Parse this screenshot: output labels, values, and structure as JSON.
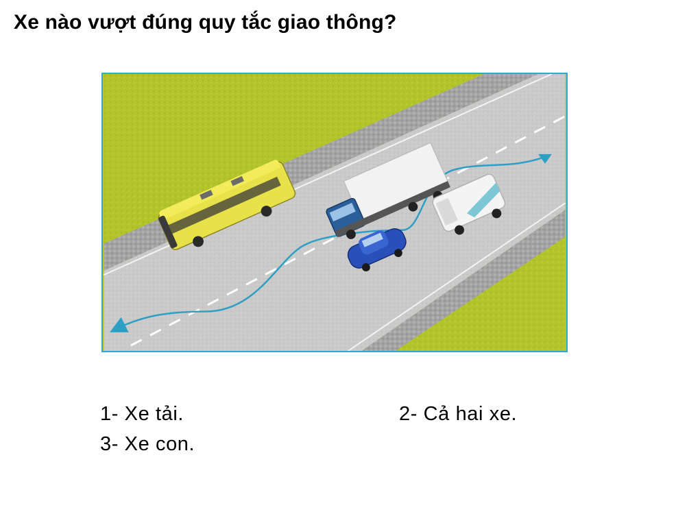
{
  "question": {
    "title": "Xe nào vượt đúng quy tắc giao thông?"
  },
  "answers": [
    {
      "label": "1- Xe tải."
    },
    {
      "label": "2- Cả hai xe."
    },
    {
      "label": "3- Xe con."
    }
  ],
  "colors": {
    "grass": "#b5c62a",
    "road": "#c9c9c9",
    "curb": "#9a9a9a",
    "lane_marking": "#ffffff",
    "path_arrow": "#2d9fc4",
    "frame_border": "#33a8cf",
    "bus": "#e8e24a",
    "truck_cab": "#2b5f9a",
    "truck_box": "#f2f2f2",
    "car": "#2850b8",
    "van": "#f4f4f4"
  },
  "icons": {
    "bus": "bus-icon",
    "truck": "truck-icon",
    "car": "car-icon",
    "van": "van-icon",
    "path": "overtake-path-arrow-icon"
  }
}
